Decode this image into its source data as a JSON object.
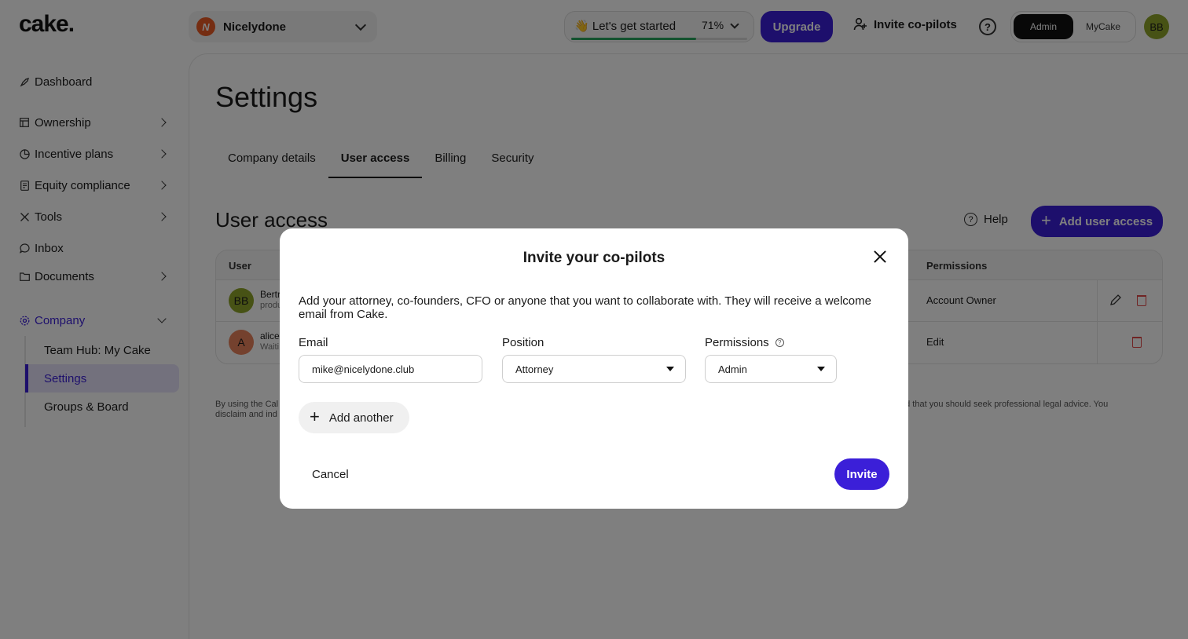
{
  "topbar": {
    "logo": "cake.",
    "company": {
      "logo_letter": "N",
      "name": "Nicelydone"
    },
    "onboarding": {
      "emoji": "👋",
      "label": "Let's get started",
      "percent_label": "71%",
      "progress": 0.71
    },
    "upgrade_label": "Upgrade",
    "invite_label": "Invite co-pilots",
    "help_glyph": "?",
    "role_toggle": {
      "admin": "Admin",
      "mycake": "MyCake",
      "active": "Admin"
    },
    "user_initials": "BB"
  },
  "sidebar": {
    "items": [
      {
        "label": "Dashboard",
        "icon": "rocket-icon"
      },
      {
        "label": "Ownership",
        "icon": "table-icon"
      },
      {
        "label": "Incentive plans",
        "icon": "pie-icon"
      },
      {
        "label": "Equity compliance",
        "icon": "doc-icon"
      },
      {
        "label": "Tools",
        "icon": "tools-icon"
      },
      {
        "label": "Inbox",
        "icon": "chat-icon"
      },
      {
        "label": "Documents",
        "icon": "folder-icon"
      },
      {
        "label": "Company",
        "icon": "gear-icon"
      }
    ],
    "subitems": [
      {
        "label": "Team Hub: My Cake"
      },
      {
        "label": "Settings"
      },
      {
        "label": "Groups & Board"
      }
    ]
  },
  "main": {
    "title": "Settings",
    "tabs": [
      {
        "label": "Company details"
      },
      {
        "label": "User access"
      },
      {
        "label": "Billing"
      },
      {
        "label": "Security"
      }
    ],
    "section_title": "User access",
    "help_label": "Help",
    "add_access_label": "Add user access",
    "table": {
      "headers": {
        "user": "User",
        "permissions": "Permissions"
      },
      "rows": [
        {
          "initials": "BB",
          "name": "Bertr",
          "sub": "produ",
          "permission": "Account Owner",
          "avatar_color": "#8fa52a"
        },
        {
          "initials": "A",
          "name": "alice",
          "sub": "Waiti",
          "permission": "Edit",
          "avatar_color": "#e8825c"
        }
      ]
    },
    "disclaimer_left_1": "By using the Cal",
    "disclaimer_left_2": "disclaim and ind",
    "disclaimer_right": "nd that you should seek professional legal advice. You"
  },
  "modal": {
    "title": "Invite your co-pilots",
    "description": "Add your attorney, co-founders, CFO or anyone that you want to collaborate with. They will receive a welcome email from Cake.",
    "email": {
      "label": "Email",
      "value": "mike@nicelydone.club"
    },
    "position": {
      "label": "Position",
      "value": "Attorney"
    },
    "permissions": {
      "label": "Permissions",
      "value": "Admin"
    },
    "add_another_label": "Add another",
    "cancel_label": "Cancel",
    "invite_label": "Invite"
  },
  "colors": {
    "accent": "#3b1fd8",
    "progress_green": "#27a55c",
    "danger": "#e04848",
    "overlay": "rgba(0,0,0,0.5)"
  }
}
